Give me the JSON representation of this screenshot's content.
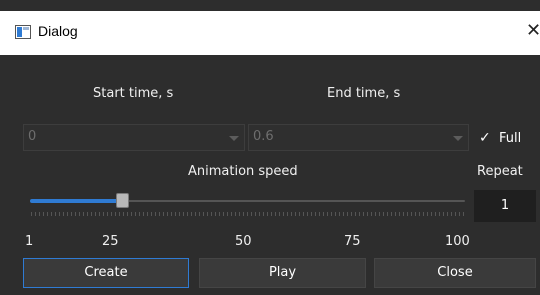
{
  "window": {
    "title": "Dialog",
    "close_glyph": "✕"
  },
  "labels": {
    "start_time": "Start time, s",
    "end_time": "End time, s",
    "animation_speed": "Animation speed",
    "repeat": "Repeat"
  },
  "start_combo": {
    "value": "0",
    "enabled": false
  },
  "end_combo": {
    "value": "0.6",
    "enabled": false
  },
  "full_checkbox": {
    "label": "Full",
    "checked": true,
    "glyph": "✓"
  },
  "speed_slider": {
    "min": 1,
    "max": 100,
    "value": 23
  },
  "scale_labels": [
    "1",
    "25",
    "50",
    "75",
    "100"
  ],
  "repeat_spin": {
    "value": "1"
  },
  "buttons": {
    "create": "Create",
    "play": "Play",
    "close": "Close"
  },
  "colors": {
    "accent": "#2f7bd3",
    "background": "#2d2d2d"
  },
  "icons": {
    "app": "app-window-icon",
    "close": "close-icon",
    "dropdown": "chevron-down-icon",
    "check": "checkmark-icon"
  }
}
